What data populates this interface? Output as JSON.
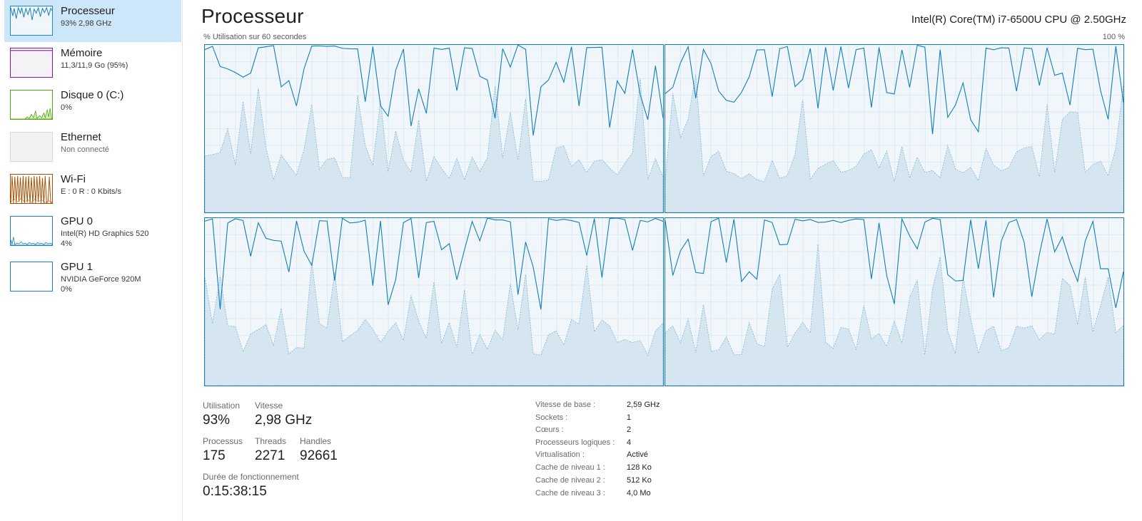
{
  "sidebar": {
    "items": [
      {
        "name": "Processeur",
        "line1": "93%  2,98 GHz",
        "line2": "",
        "thumb_color": "#117dbb",
        "thumb_fill": "#f1f6fa"
      },
      {
        "name": "Mémoire",
        "line1": "11,3/11,9 Go (95%)",
        "line2": "",
        "thumb_color": "#8b12ae",
        "thumb_fill": "#f4f2f4"
      },
      {
        "name": "Disque 0 (C:)",
        "line1": "0%",
        "line2": "",
        "thumb_color": "#4da60c",
        "thumb_fill": "#ffffff"
      },
      {
        "name": "Ethernet",
        "line1": "Non connecté",
        "line2": "",
        "thumb_color": "#d8d8d8",
        "thumb_fill": "#f2f2f2"
      },
      {
        "name": "Wi-Fi",
        "line1": "E : 0  R : 0 Kbits/s",
        "line2": "",
        "thumb_color": "#a74f01",
        "thumb_fill": "#ffffff"
      },
      {
        "name": "GPU 0",
        "line1": "Intel(R) HD Graphics 520",
        "line2": "4%",
        "thumb_color": "#117dbb",
        "thumb_fill": "#ffffff"
      },
      {
        "name": "GPU 1",
        "line1": "NVIDIA GeForce 920M",
        "line2": "0%",
        "thumb_color": "#117dbb",
        "thumb_fill": "#ffffff"
      }
    ]
  },
  "main": {
    "title": "Processeur",
    "cpu_model": "Intel(R) Core(TM) i7-6500U CPU @ 2.50GHz",
    "util_caption": "% Utilisation sur 60 secondes",
    "util_max": "100 %",
    "graph_colors": {
      "line": "#117dbb",
      "fill": "#f1f6fa",
      "grid": "#d9eaf7",
      "kernel_line": "#7fb4d8",
      "kernel_fill": "#d6e6f0"
    },
    "graphs_count": 4
  },
  "stats": {
    "utilisation_label": "Utilisation",
    "utilisation_value": "93%",
    "vitesse_label": "Vitesse",
    "vitesse_value": "2,98 GHz",
    "processus_label": "Processus",
    "processus_value": "175",
    "threads_label": "Threads",
    "threads_value": "2271",
    "handles_label": "Handles",
    "handles_value": "92661",
    "uptime_label": "Durée de fonctionnement",
    "uptime_value": "0:15:38:15"
  },
  "details": [
    {
      "label": "Vitesse de base :",
      "value": "2,59 GHz"
    },
    {
      "label": "Sockets :",
      "value": "1"
    },
    {
      "label": "Cœurs :",
      "value": "2"
    },
    {
      "label": "Processeurs logiques :",
      "value": "4"
    },
    {
      "label": "Virtualisation :",
      "value": "Activé"
    },
    {
      "label": "Cache de niveau 1 :",
      "value": "128 Ko"
    },
    {
      "label": "Cache de niveau 2 :",
      "value": "512 Ko"
    },
    {
      "label": "Cache de niveau 3 :",
      "value": "4,0 Mo"
    }
  ]
}
